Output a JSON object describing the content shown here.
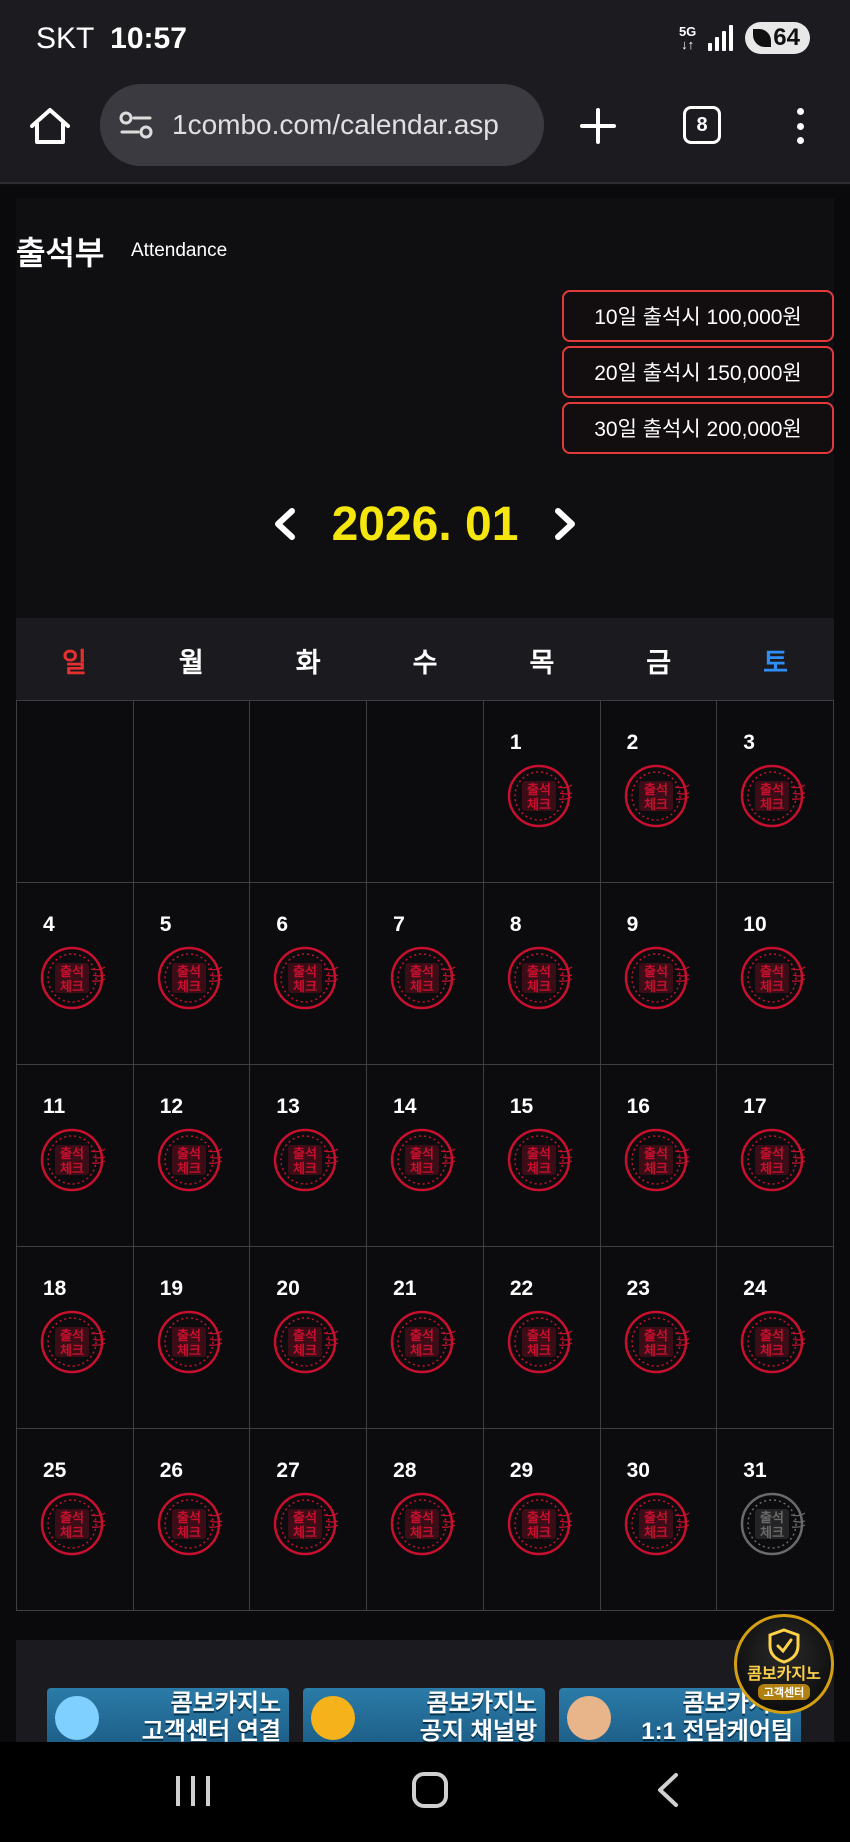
{
  "status": {
    "carrier": "SKT",
    "time": "10:57",
    "network": "5G",
    "battery": "64"
  },
  "browser": {
    "url": "1combo.com/calendar.asp",
    "tab_count": "8"
  },
  "header": {
    "title": "출석부",
    "subtitle": "Attendance"
  },
  "rewards": [
    "10일 출석시 100,000원",
    "20일 출석시 150,000원",
    "30일 출석시 200,000원"
  ],
  "calendar": {
    "month_label": "2026. 01",
    "weekdays": [
      "일",
      "월",
      "화",
      "수",
      "목",
      "금",
      "토"
    ],
    "leading_blanks": 4,
    "days_in_month": 31,
    "checked_days": [
      1,
      2,
      3,
      4,
      5,
      6,
      7,
      8,
      9,
      10,
      11,
      12,
      13,
      14,
      15,
      16,
      17,
      18,
      19,
      20,
      21,
      22,
      23,
      24,
      25,
      26,
      27,
      28,
      29,
      30
    ],
    "unchecked_days": [
      31
    ],
    "stamp_text": [
      "출석",
      "체크"
    ],
    "stamp_color_checked": "#c8102e",
    "stamp_color_unchecked": "#6a6a6a"
  },
  "banners": [
    {
      "line1": "콤보카지노",
      "line2": "고객센터 연결"
    },
    {
      "line1": "콤보카지노",
      "line2": "공지 채널방"
    },
    {
      "line1": "콤보카지노",
      "line2": "1:1 전담케어팀"
    }
  ],
  "floating_badge": {
    "title": "콤보카지노",
    "subtitle": "고객센터"
  },
  "colors": {
    "accent_month": "#f5e60e",
    "sunday": "#e63030",
    "saturday": "#2f8ef5",
    "reward_border": "#e03a3a"
  }
}
